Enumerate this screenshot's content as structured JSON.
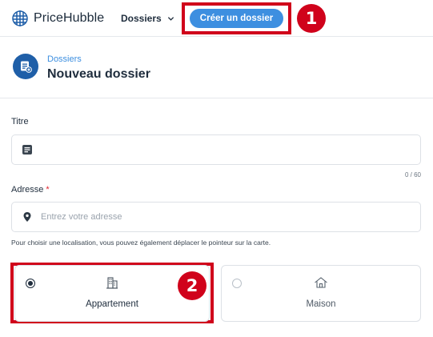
{
  "app": {
    "logo_text": "PriceHubble"
  },
  "nav": {
    "dossiers_label": "Dossiers",
    "create_label": "Créer un dossier"
  },
  "annotations": {
    "badge_1": "1",
    "badge_2": "2",
    "color": "#d0021b"
  },
  "header": {
    "breadcrumb": "Dossiers",
    "title": "Nouveau dossier"
  },
  "form": {
    "title_label": "Titre",
    "title_value": "",
    "title_counter": "0 / 60",
    "address_label": "Adresse",
    "address_required": "*",
    "address_placeholder": "Entrez votre adresse",
    "address_hint": "Pour choisir une localisation, vous pouvez également déplacer le pointeur sur la carte.",
    "property_types": [
      {
        "label": "Appartement",
        "icon": "apartment-building-icon",
        "selected": true
      },
      {
        "label": "Maison",
        "icon": "house-icon",
        "selected": false
      }
    ]
  },
  "colors": {
    "primary": "#3d8fe0",
    "brand_dark": "#1f5fa8",
    "annotation": "#d0021b"
  }
}
